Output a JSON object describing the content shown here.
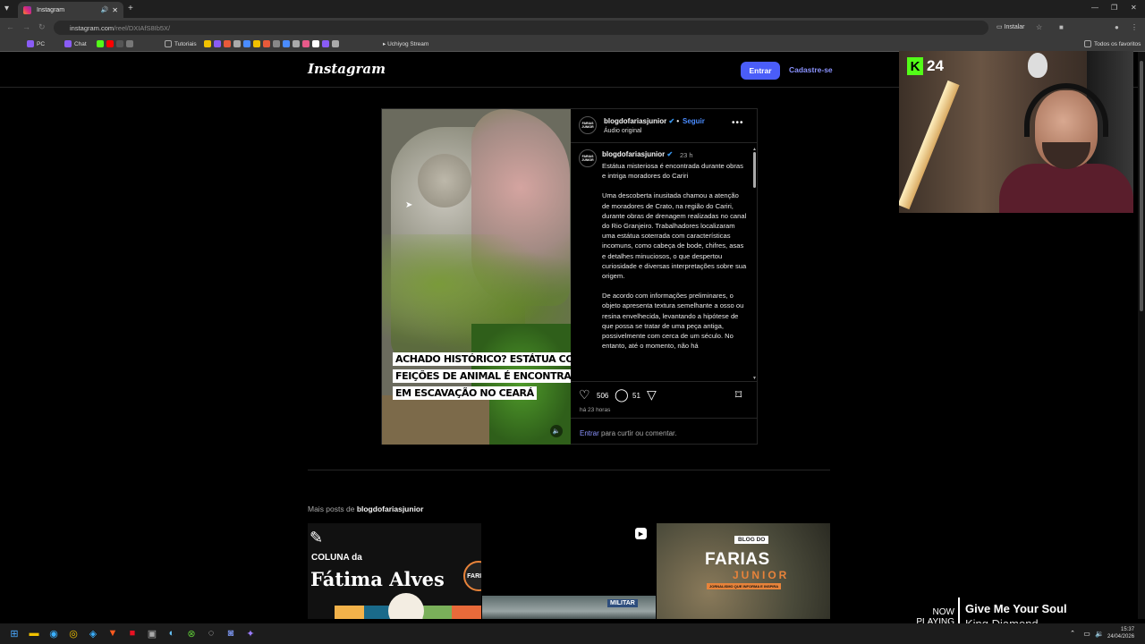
{
  "browser": {
    "tab_title": "Instagram",
    "url": "instagram.com",
    "url_path": "/reel/DXIAfS8Ib5X/",
    "install_label": "Instalar",
    "bookmarks": [
      {
        "label": "PC",
        "color": "#8a5cf6"
      },
      {
        "label": "Chat",
        "color": "#8a5cf6"
      },
      {
        "label": "Tutoriais",
        "color": "#888888"
      },
      {
        "label": "Uchiyog Stream",
        "color": "#4a8cff"
      }
    ],
    "all_favorites": "Todos os favoritos"
  },
  "instagram": {
    "logo": "Instagram",
    "login_label": "Entrar",
    "signup_label": "Cadastre-se"
  },
  "post": {
    "username": "blogdofariasjunior",
    "follow_label": "Seguir",
    "audio": "Áudio original",
    "avatar_text": "FARIAS JUNIOR",
    "time": "23 h",
    "overlay_lines": [
      "ACHADO HISTÓRICO? ESTÁTUA COM",
      "FEIÇÕES DE ANIMAL É ENCONTRADA",
      "EM ESCAVAÇÃO NO CEARÁ"
    ],
    "caption_paragraphs": [
      "Estátua misteriosa é encontrada durante obras e intriga moradores do Cariri",
      "Uma descoberta inusitada chamou a atenção de moradores de Crato, na região do Cariri, durante obras de drenagem realizadas no canal do Rio Granjeiro. Trabalhadores localizaram uma estátua soterrada com características incomuns, como cabeça de bode, chifres, asas e detalhes minuciosos, o que despertou curiosidade e diversas interpretações sobre sua origem.",
      "De acordo com informações preliminares, o objeto apresenta textura semelhante a osso ou resina envelhecida, levantando a hipótese de que possa se tratar de uma peça antiga, possivelmente com cerca de um século. No entanto, até o momento, não há"
    ],
    "likes": "506",
    "comments": "51",
    "ago": "há 23 horas",
    "login_link": "Entrar",
    "login_rest": " para curtir ou comentar."
  },
  "more_posts": {
    "prefix": "Mais posts de ",
    "user": "blogdofariasjunior",
    "thumb1": {
      "col": "COLUNA da",
      "name": "Fátima Alves",
      "badge": "FARIAS"
    },
    "thumb2": {
      "sign": "MILITAR"
    },
    "thumb3": {
      "blogdo": "BLOG DO",
      "farias": "FARIAS",
      "junior": "JUNIOR",
      "tag": "JORNALISMO QUE INFORMA E INSPIRA"
    }
  },
  "stream": {
    "kick_count": "24",
    "now_playing": "NOW PLAYING",
    "song": "Give Me Your Soul",
    "artist": "King Diamond"
  },
  "taskbar": {
    "time": "15:37",
    "date": "24/04/2026"
  }
}
